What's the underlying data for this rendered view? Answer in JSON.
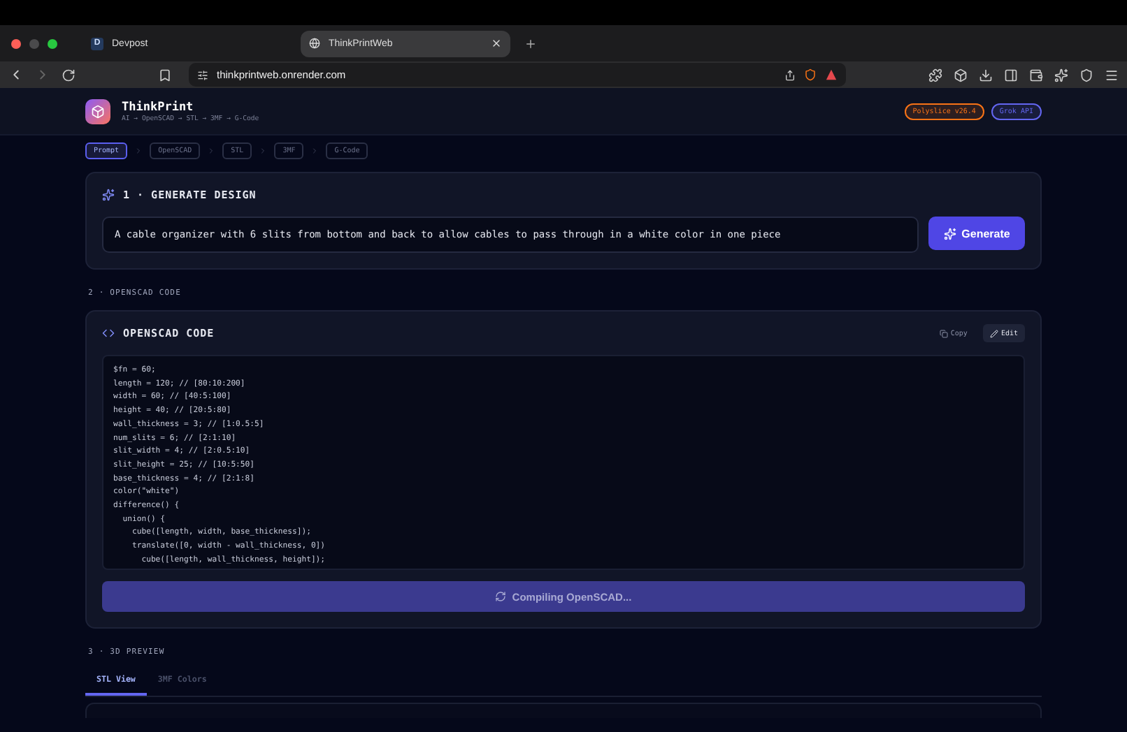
{
  "browser": {
    "tabs": [
      {
        "title": "Devpost",
        "badge": "D",
        "selected": false
      },
      {
        "title": "ThinkPrintWeb",
        "selected": true
      }
    ],
    "url": "thinkprintweb.onrender.com"
  },
  "header": {
    "app_name": "ThinkPrint",
    "tagline": "AI → OpenSCAD → STL → 3MF → G-Code",
    "badges": [
      {
        "label": "Polyslice v26.4",
        "color": "#f97316"
      },
      {
        "label": "Grok API",
        "color": "#6366f1"
      }
    ]
  },
  "steps": [
    {
      "label": "Prompt",
      "selected": true
    },
    {
      "label": "OpenSCAD",
      "selected": false
    },
    {
      "label": "STL",
      "selected": false
    },
    {
      "label": "3MF",
      "selected": false
    },
    {
      "label": "G-Code",
      "selected": false
    }
  ],
  "generate": {
    "title": "1 · GENERATE DESIGN",
    "prompt": "A cable organizer with 6 slits from bottom and back to allow cables to pass through in a white color in one piece",
    "button": "Generate"
  },
  "openscad_section": {
    "label": "2 · OPENSCAD CODE",
    "title": "OPENSCAD CODE",
    "copy": "Copy",
    "edit": "Edit",
    "code_lines": [
      "$fn = 60;",
      "length = 120; // [80:10:200]",
      "width = 60; // [40:5:100]",
      "height = 40; // [20:5:80]",
      "wall_thickness = 3; // [1:0.5:5]",
      "num_slits = 6; // [2:1:10]",
      "slit_width = 4; // [2:0.5:10]",
      "slit_height = 25; // [10:5:50]",
      "base_thickness = 4; // [2:1:8]",
      "color(\"white\")",
      "difference() {",
      "  union() {",
      "    cube([length, width, base_thickness]);",
      "    translate([0, width - wall_thickness, 0])",
      "      cube([length, wall_thickness, height]);"
    ],
    "compile_button": "Compiling OpenSCAD..."
  },
  "preview_section": {
    "label": "3 · 3D PREVIEW",
    "tabs": [
      {
        "label": "STL View",
        "selected": true
      },
      {
        "label": "3MF Colors",
        "selected": false
      }
    ]
  }
}
